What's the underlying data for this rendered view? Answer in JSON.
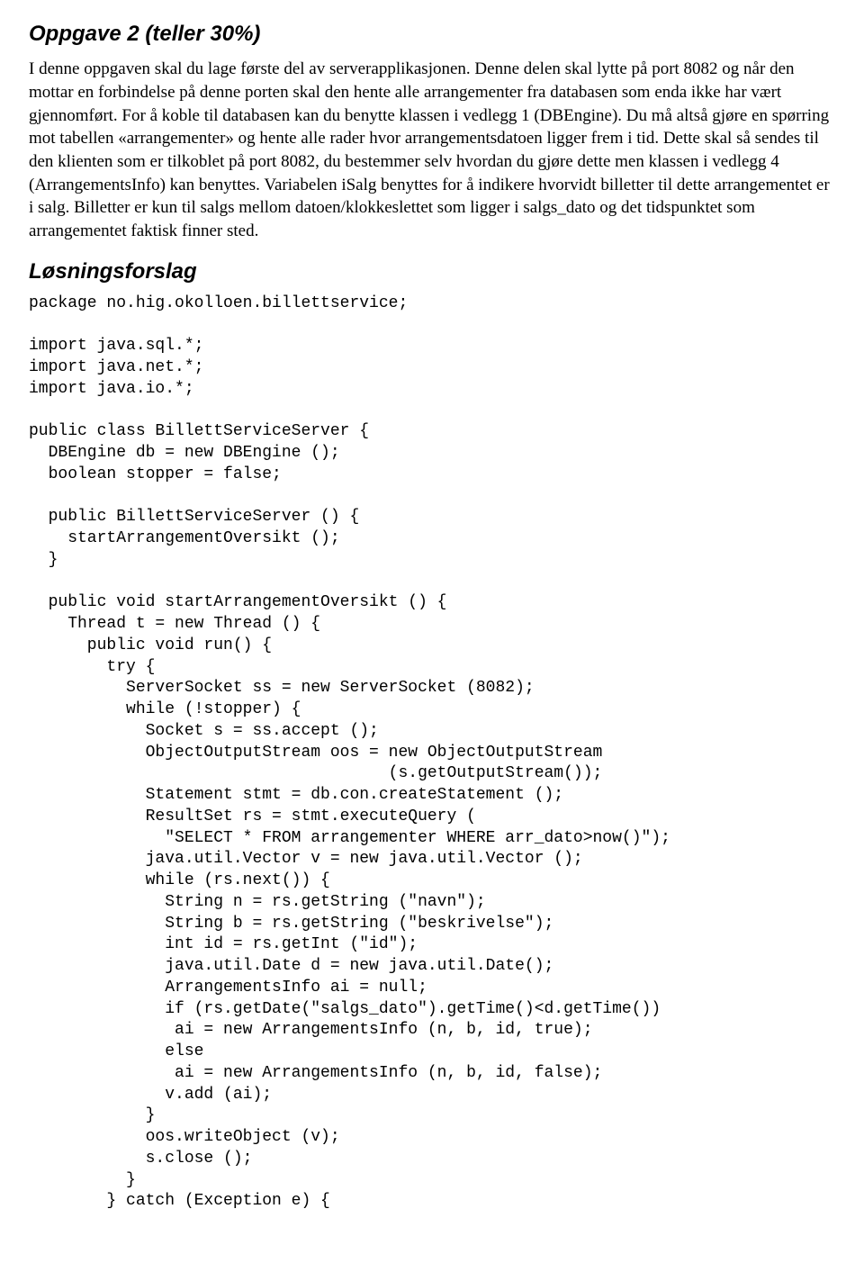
{
  "task": {
    "title": "Oppgave 2 (teller 30%)",
    "body": "I denne oppgaven skal du lage første del av serverapplikasjonen. Denne delen skal lytte på port 8082 og når den mottar en forbindelse på denne porten skal den hente alle arrangementer fra databasen som enda ikke har vært gjennomført. For å koble til databasen kan du benytte klassen i vedlegg 1 (DBEngine). Du må altså gjøre en spørring mot tabellen «arrangementer» og hente alle rader hvor arrangementsdatoen ligger frem i tid. Dette skal så sendes til den klienten som er tilkoblet på port 8082, du bestemmer selv hvordan du gjøre dette men klassen i vedlegg 4 (ArrangementsInfo) kan benyttes. Variabelen iSalg benyttes for å indikere hvorvidt billetter til dette arrangementet er i salg. Billetter er kun til salgs mellom datoen/klokkeslettet som ligger i salgs_dato og det tidspunktet som arrangementet faktisk finner sted."
  },
  "solution": {
    "title": "Løsningsforslag",
    "code": "package no.hig.okolloen.billettservice;\n\nimport java.sql.*;\nimport java.net.*;\nimport java.io.*;\n\npublic class BillettServiceServer {\n  DBEngine db = new DBEngine ();\n  boolean stopper = false;\n\n  public BillettServiceServer () {\n    startArrangementOversikt ();\n  }\n\n  public void startArrangementOversikt () {\n    Thread t = new Thread () {\n      public void run() {\n        try {\n          ServerSocket ss = new ServerSocket (8082);\n          while (!stopper) {\n            Socket s = ss.accept ();\n            ObjectOutputStream oos = new ObjectOutputStream\n                                     (s.getOutputStream());\n            Statement stmt = db.con.createStatement ();\n            ResultSet rs = stmt.executeQuery (\n              \"SELECT * FROM arrangementer WHERE arr_dato>now()\");\n            java.util.Vector v = new java.util.Vector ();\n            while (rs.next()) {\n              String n = rs.getString (\"navn\");\n              String b = rs.getString (\"beskrivelse\");\n              int id = rs.getInt (\"id\");\n              java.util.Date d = new java.util.Date();\n              ArrangementsInfo ai = null;\n              if (rs.getDate(\"salgs_dato\").getTime()<d.getTime())\n               ai = new ArrangementsInfo (n, b, id, true);\n              else\n               ai = new ArrangementsInfo (n, b, id, false);\n              v.add (ai);\n            }\n            oos.writeObject (v);\n            s.close ();\n          }\n        } catch (Exception e) {"
  }
}
